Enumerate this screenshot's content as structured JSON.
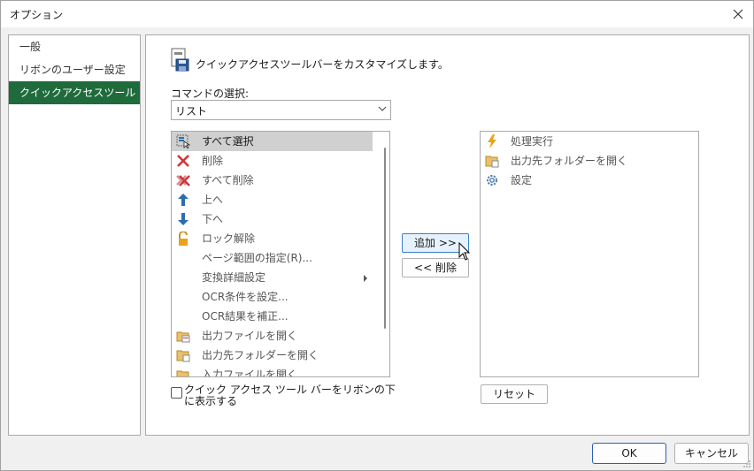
{
  "window": {
    "title": "オプション"
  },
  "nav": {
    "items": [
      {
        "label": "一般"
      },
      {
        "label": "リボンのユーザー設定"
      },
      {
        "label": "クイックアクセスツールバー"
      }
    ]
  },
  "panel": {
    "heading": "クイックアクセスツールバーをカスタマイズします。",
    "command_label": "コマンドの選択:",
    "command_select": "リスト",
    "available_commands": [
      {
        "label": "すべて選択",
        "icon": "select-all-icon"
      },
      {
        "label": "削除",
        "icon": "delete-x-icon"
      },
      {
        "label": "すべて削除",
        "icon": "delete-all-icon"
      },
      {
        "label": "上へ",
        "icon": "arrow-up-icon"
      },
      {
        "label": "下へ",
        "icon": "arrow-down-icon"
      },
      {
        "label": "ロック解除",
        "icon": "unlock-icon"
      },
      {
        "label": "ページ範囲の指定(R)...",
        "icon": ""
      },
      {
        "label": "変換詳細設定",
        "icon": ""
      },
      {
        "label": "OCR条件を設定...",
        "icon": ""
      },
      {
        "label": "OCR結果を補正...",
        "icon": ""
      },
      {
        "label": "出力ファイルを開く",
        "icon": "open-output-file-icon"
      },
      {
        "label": "出力先フォルダーを開く",
        "icon": "open-output-folder-icon"
      },
      {
        "label": "入力ファイルを開く",
        "icon": "open-input-file-icon"
      }
    ],
    "add_button": "追加 >>",
    "remove_button": "<< 削除",
    "toolbar_commands": [
      {
        "label": "処理実行",
        "icon": "lightning-icon"
      },
      {
        "label": "出力先フォルダーを開く",
        "icon": "open-output-folder-icon"
      },
      {
        "label": "設定",
        "icon": "gear-icon"
      }
    ],
    "reset_button": "リセット",
    "show_below_ribbon": "クイック アクセス ツール バーをリボンの下に表示する"
  },
  "footer": {
    "ok": "OK",
    "cancel": "キャンセル"
  },
  "colors": {
    "nav_active": "#1f6b3c",
    "delete_red": "#d13438",
    "arrow_blue": "#2b6cb0",
    "lightning_orange": "#e8a317"
  }
}
